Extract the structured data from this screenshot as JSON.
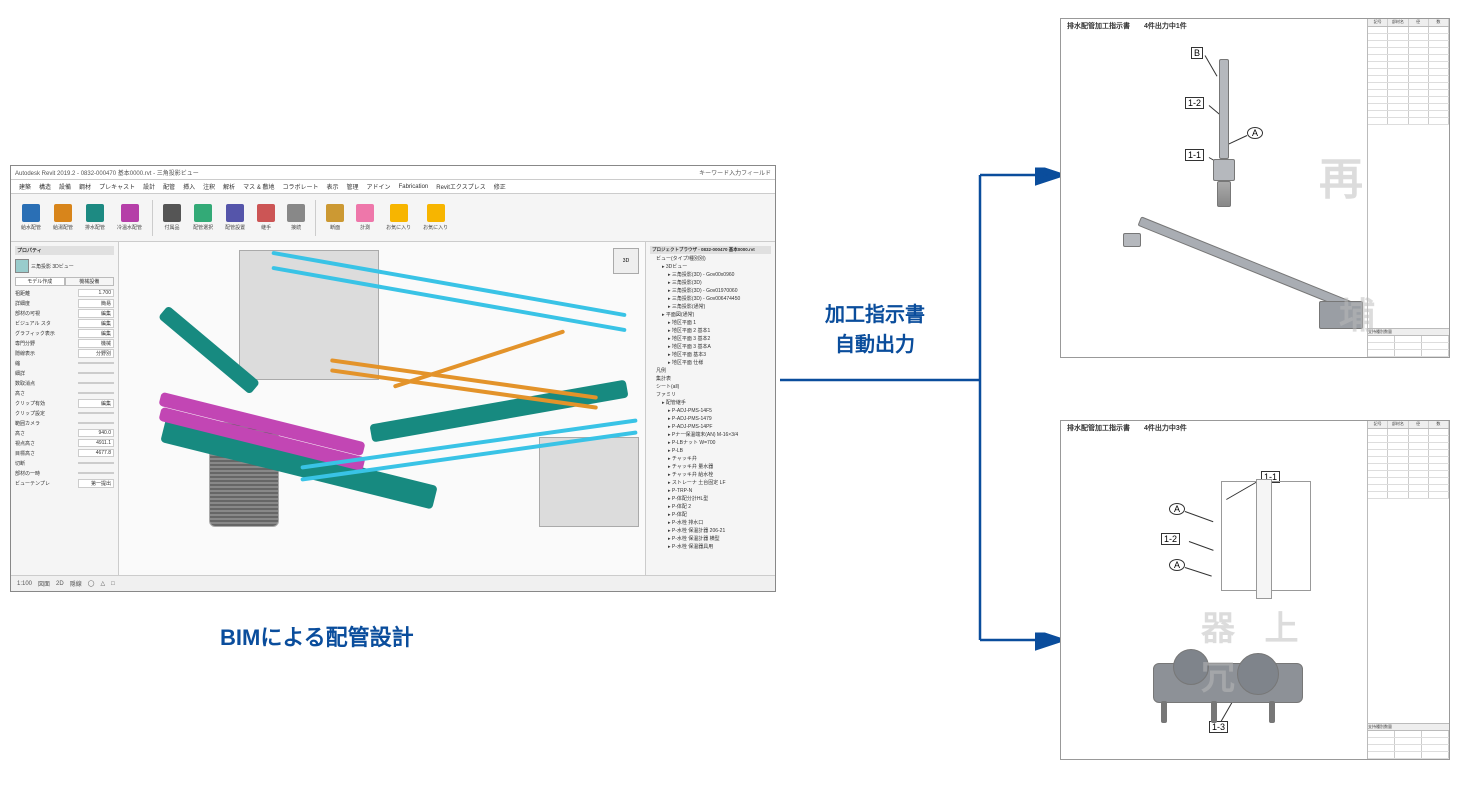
{
  "bim": {
    "title_left": "Autodesk Revit 2019.2 - 0832-000470 基本0000.rvt - 三角投影ビュー",
    "title_right": "キーワード入力フィールド",
    "menu": [
      "建築",
      "構造",
      "設備",
      "鋼材",
      "プレキャスト",
      "設計",
      "配管",
      "挿入",
      "注釈",
      "解析",
      "マス & 敷地",
      "コラボレート",
      "表示",
      "管理",
      "アドイン",
      "Fabrication",
      "Revitエクスプレス",
      "修正"
    ],
    "ribbon": [
      {
        "label": "給水配管",
        "color": "#2a6fb5"
      },
      {
        "label": "給湯配管",
        "color": "#d8851b"
      },
      {
        "label": "排水配管",
        "color": "#1d8a82"
      },
      {
        "label": "冷温水配管",
        "color": "#b53fa8"
      },
      {
        "label": "付属品",
        "color": "#555"
      },
      {
        "label": "配管選択",
        "color": "#3a7"
      },
      {
        "label": "配管設置",
        "color": "#55a"
      },
      {
        "label": "継手",
        "color": "#c55"
      },
      {
        "label": "接続",
        "color": "#888"
      },
      {
        "label": "断面",
        "color": "#c93"
      },
      {
        "label": "計測",
        "color": "#e7a"
      },
      {
        "label": "お気に入り",
        "color": "#f7b500"
      },
      {
        "label": "お気に入り",
        "color": "#f7b500"
      }
    ],
    "left_panel": {
      "header": "プロパティ",
      "view_label": "三角投影 3Dビュー",
      "tabs": [
        "モデル作成",
        "機械設備"
      ],
      "rows": [
        {
          "k": "祖距離",
          "v": "1.700"
        },
        {
          "k": "詳細度",
          "v": "簡易"
        },
        {
          "k": "部材の可視",
          "v": "編集"
        },
        {
          "k": "ビジュアル スタ",
          "v": "編集"
        },
        {
          "k": "グラフィック表示",
          "v": "編集"
        },
        {
          "k": "専門分野",
          "v": "機械"
        },
        {
          "k": "隠線表示",
          "v": "分野別"
        },
        {
          "k": "縮",
          "v": ""
        },
        {
          "k": "細詳",
          "v": ""
        },
        {
          "k": "数取消点",
          "v": ""
        },
        {
          "k": "高さ",
          "v": ""
        },
        {
          "k": "クリップ有効",
          "v": "編集"
        },
        {
          "k": "クリップ設定",
          "v": ""
        },
        {
          "k": "範囲カメラ",
          "v": ""
        },
        {
          "k": "高さ",
          "v": "940.0"
        },
        {
          "k": "視点高さ",
          "v": "4911.1"
        },
        {
          "k": "目標高さ",
          "v": "4677.8"
        },
        {
          "k": "切断",
          "v": ""
        },
        {
          "k": "部材の一時",
          "v": ""
        },
        {
          "k": "ビューテンプレ",
          "v": "第一提出"
        }
      ]
    },
    "right_panel": {
      "header": "プロジェクトブラウザ - 0832-000470 基本0000.rvt",
      "items": [
        {
          "t": "ビュー(タイプ/種別別)",
          "l": 1
        },
        {
          "t": "3Dビュー",
          "l": 2
        },
        {
          "t": "三角投影(3D) - Gov00x0960",
          "l": 3
        },
        {
          "t": "三角投影(3D)",
          "l": 3
        },
        {
          "t": "三角投影(3D) - Gov01970060",
          "l": 3
        },
        {
          "t": "三角投影(3D) - Gov006474450",
          "l": 3
        },
        {
          "t": "三角投影(通常)",
          "l": 3
        },
        {
          "t": "平面図(通常)",
          "l": 2
        },
        {
          "t": "地区平面 1",
          "l": 3
        },
        {
          "t": "地区平面 2 基本1",
          "l": 3
        },
        {
          "t": "地区平面 3 基本2",
          "l": 3
        },
        {
          "t": "地区平面 3 基本A",
          "l": 3
        },
        {
          "t": "地区平面 基本3",
          "l": 3
        },
        {
          "t": "地区平面 仕様",
          "l": 3
        },
        {
          "t": "凡例",
          "l": 1
        },
        {
          "t": "集計表",
          "l": 1
        },
        {
          "t": "シート(all)",
          "l": 1
        },
        {
          "t": "ファミリ",
          "l": 1
        },
        {
          "t": "配管継手",
          "l": 2
        },
        {
          "t": "P-ADJ-PMS-14F5",
          "l": 3
        },
        {
          "t": "P-ADJ-PMS-1479",
          "l": 3
        },
        {
          "t": "P-ADJ-PMS-14PF",
          "l": 3
        },
        {
          "t": "Pナー保温端末(AN) M-16×3/4",
          "l": 3
        },
        {
          "t": "P-LBナット W=700",
          "l": 3
        },
        {
          "t": "P-LB",
          "l": 3
        },
        {
          "t": "チャッキ弁",
          "l": 3
        },
        {
          "t": "チャッキ弁 量水器",
          "l": 3
        },
        {
          "t": "チャッキ弁 給水栓",
          "l": 3
        },
        {
          "t": "ストレーナ 土台固定 LF",
          "l": 3
        },
        {
          "t": "P-TRP-N",
          "l": 3
        },
        {
          "t": "P-体配分計HL型",
          "l": 3
        },
        {
          "t": "P-体配 2",
          "l": 3
        },
        {
          "t": "P-体配",
          "l": 3
        },
        {
          "t": "P-水栓 排水口",
          "l": 3
        },
        {
          "t": "P-水栓 保温計器 206-21",
          "l": 3
        },
        {
          "t": "P-水栓 保温計器 横型",
          "l": 3
        },
        {
          "t": "P-水栓 保温器具用",
          "l": 3
        }
      ]
    },
    "status": [
      "1:100",
      "図面",
      "2D",
      "隠線",
      "◯",
      "△",
      "□"
    ]
  },
  "caption_bim": "BIMによる配管設計",
  "center_label_1": "加工指示書",
  "center_label_2": "自動出力",
  "doc1": {
    "title": "排水配管加工指示書",
    "subtitle": "4件出力中1件",
    "callouts": [
      "B",
      "1-2",
      "A",
      "1-1"
    ],
    "watermark": "再",
    "table_head": [
      "記号",
      "部材名",
      "径",
      "数"
    ],
    "rows": 14,
    "sec2": [
      "支持",
      "種別",
      "数量"
    ]
  },
  "doc2": {
    "title": "排水配管加工指示書",
    "subtitle": "4件出力中3件",
    "callouts": [
      "1-1",
      "A",
      "1-2",
      "A",
      "1-3"
    ],
    "watermark": "器 上 冗",
    "table_head": [
      "記号",
      "部材名",
      "径",
      "数"
    ],
    "rows": 10,
    "sec2": [
      "支持",
      "種別",
      "数量"
    ]
  }
}
